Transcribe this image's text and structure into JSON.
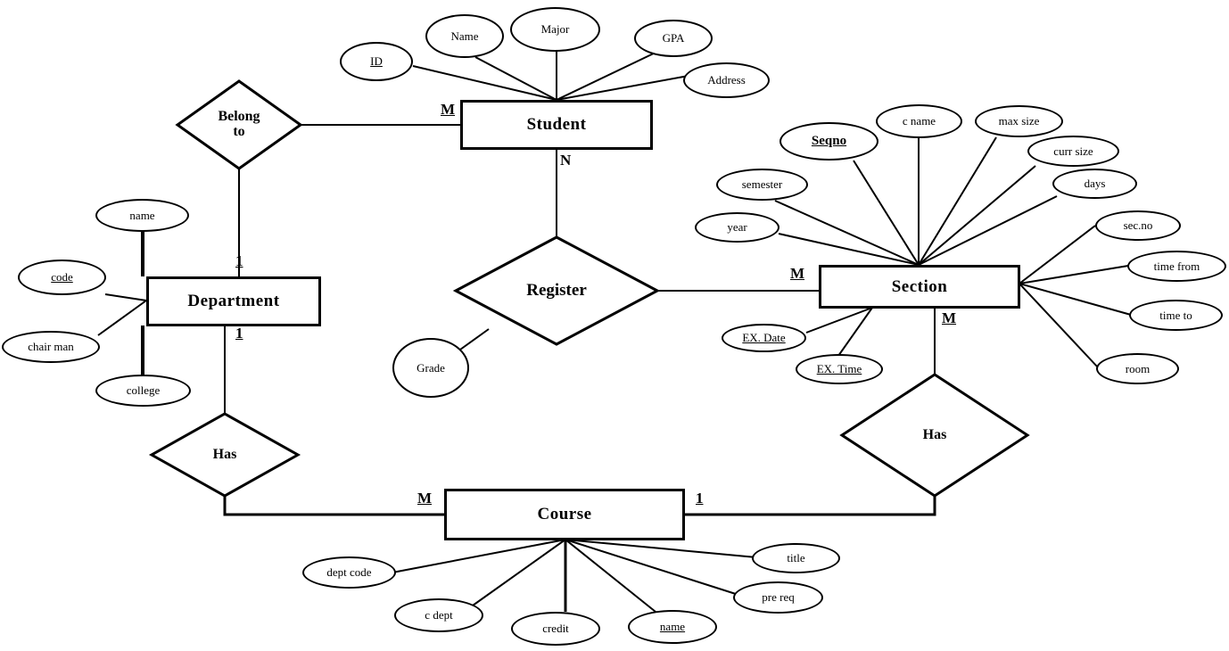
{
  "diagram": {
    "title": "University ER Diagram",
    "type": "entity-relationship-diagram",
    "entities": [
      {
        "id": "student",
        "label": "Student"
      },
      {
        "id": "department",
        "label": "Department"
      },
      {
        "id": "section",
        "label": "Section"
      },
      {
        "id": "course",
        "label": "Course"
      }
    ],
    "relationships": [
      {
        "id": "belong-to",
        "label": "Belong\nto",
        "line1": "Belong",
        "line2": "to"
      },
      {
        "id": "register",
        "label": "Register"
      },
      {
        "id": "has-dept-course",
        "label": "Has"
      },
      {
        "id": "has-course-section",
        "label": "Has"
      }
    ],
    "attributes": {
      "student": [
        "ID",
        "Name",
        "Major",
        "GPA",
        "Address"
      ],
      "department": [
        "name",
        "code",
        "chair man",
        "college"
      ],
      "section": [
        "Seqno",
        "semester",
        "year",
        "c name",
        "max size",
        "curr size",
        "days",
        "sec.no",
        "time from",
        "time to",
        "room",
        "EX. Date",
        "EX. Time"
      ],
      "course": [
        "dept code",
        "c dept",
        "credit",
        "name",
        "pre req",
        "title"
      ],
      "register": [
        "Grade"
      ]
    },
    "keys": [
      "ID",
      "code",
      "Seqno",
      "name (Course)",
      "EX. Date",
      "EX. Time"
    ],
    "cardinalities": [
      "M",
      "N",
      "1",
      "M",
      "M",
      "1",
      "M",
      "1"
    ]
  },
  "entities": {
    "student": {
      "label": "Student"
    },
    "department": {
      "label": "Department"
    },
    "section": {
      "label": "Section"
    },
    "course": {
      "label": "Course"
    }
  },
  "relationships": {
    "belong_to_line1": "Belong",
    "belong_to_line2": "to",
    "register": "Register",
    "has_left": "Has",
    "has_right": "Has"
  },
  "student_attrs": {
    "id": "ID",
    "name": "Name",
    "major": "Major",
    "gpa": "GPA",
    "address": "Address"
  },
  "department_attrs": {
    "name": "name",
    "code": "code",
    "chair_man": "chair man",
    "college": "college"
  },
  "section_attrs": {
    "seqno": "Seqno",
    "semester": "semester",
    "year": "year",
    "c_name": "c name",
    "max_size": "max size",
    "curr_size": "curr size",
    "days": "days",
    "sec_no": "sec.no",
    "time_from": "time from",
    "time_to": "time to",
    "room": "room",
    "ex_date": "EX. Date",
    "ex_time": "EX. Time"
  },
  "course_attrs": {
    "dept_code": "dept code",
    "c_dept": "c dept",
    "credit": "credit",
    "name": "name",
    "pre_req": "pre req",
    "title": "title"
  },
  "register_attrs": {
    "grade": "Grade"
  },
  "cardinalities": {
    "student_left_m": "M",
    "student_bottom_n": "N",
    "dept_top_1": "1",
    "dept_bottom_1": "1",
    "section_left_m": "M",
    "section_bottom_m": "M",
    "course_left_m": "M",
    "course_right_1": "1"
  },
  "colors": {
    "stroke": "#000000",
    "background": "#ffffff",
    "text": "#000000"
  }
}
